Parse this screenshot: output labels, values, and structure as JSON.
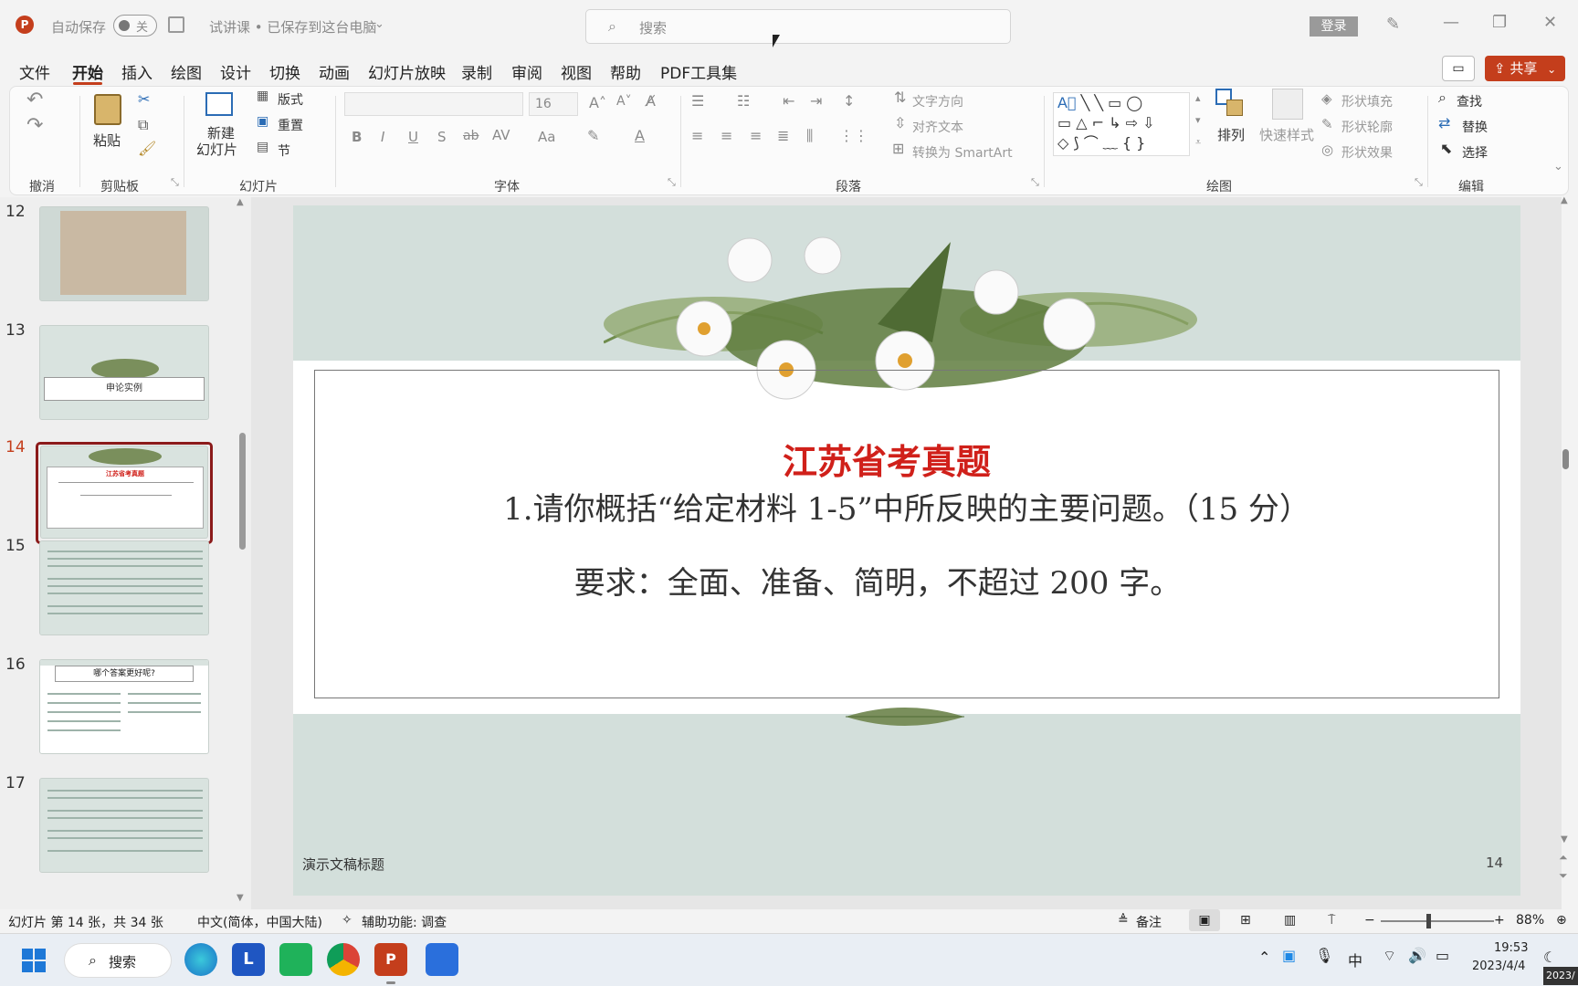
{
  "titlebar": {
    "autosave_label": "自动保存",
    "autosave_state": "关",
    "doc_title": "试讲课 • 已保存到这台电脑",
    "search_placeholder": "搜索",
    "login": "登录"
  },
  "menu": {
    "items": [
      "文件",
      "开始",
      "插入",
      "绘图",
      "设计",
      "切换",
      "动画",
      "幻灯片放映",
      "录制",
      "审阅",
      "视图",
      "帮助",
      "PDF工具集"
    ],
    "active": "开始",
    "share": "共享"
  },
  "ribbon": {
    "groups": {
      "undo": "撤消",
      "clipboard": "剪贴板",
      "slides": "幻灯片",
      "font": "字体",
      "paragraph": "段落",
      "drawing": "绘图",
      "editing": "编辑"
    },
    "paste": "粘贴",
    "new_slide": "新建\n幻灯片",
    "new_slide_line1": "新建",
    "new_slide_line2": "幻灯片",
    "layout": "版式",
    "reset": "重置",
    "section": "节",
    "font_size": "16",
    "text_direction": "文字方向",
    "align_text": "对齐文本",
    "convert_smartart": "转换为 SmartArt",
    "arrange": "排列",
    "quick_styles": "快速样式",
    "shape_fill": "形状填充",
    "shape_outline": "形状轮廓",
    "shape_effects": "形状效果",
    "find": "查找",
    "replace": "替换",
    "select": "选择"
  },
  "thumbnails": [
    {
      "num": "12",
      "text": ""
    },
    {
      "num": "13",
      "text": "申论实例"
    },
    {
      "num": "14",
      "text": "江苏省考真题"
    },
    {
      "num": "15",
      "text": ""
    },
    {
      "num": "16",
      "text": "哪个答案更好呢?"
    },
    {
      "num": "17",
      "text": ""
    }
  ],
  "slide": {
    "title": "江苏省考真题",
    "question": "1.请你概括“给定材料 1-5”中所反映的主要问题。（15 分）",
    "requirement": "要求：全面、准备、简明，不超过 200 字。",
    "footer": "演示文稿标题",
    "page_number": "14"
  },
  "status": {
    "slide_info": "幻灯片 第 14 张，共 34 张",
    "language": "中文(简体，中国大陆)",
    "accessibility": "辅助功能: 调查",
    "notes": "备注",
    "zoom": "88%"
  },
  "taskbar": {
    "search": "搜索",
    "ime": "中",
    "time": "19:53",
    "date": "2023/4/4",
    "date_short": "2023/"
  },
  "colors": {
    "accent": "#c43e1c",
    "slide_bg": "#d3dfdb",
    "title_red": "#d0201a",
    "selected_thumb": "#8b1a1a"
  }
}
